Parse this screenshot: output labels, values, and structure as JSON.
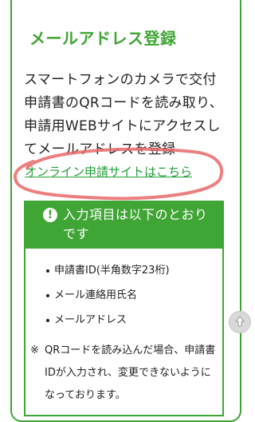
{
  "section": {
    "title": "メールアドレス登録",
    "description": "スマートフォンのカメラで交付申請書のQRコードを読み取り、申請用WEBサイトにアクセスしてメールアドレスを登録",
    "link_label": "オンライン申請サイトはこちら"
  },
  "info": {
    "icon": "exclamation-icon",
    "title": "入力項目は以下のとおりです",
    "items": [
      "申請書ID(半角数字23桁)",
      "メール連絡用氏名",
      "メールアドレス"
    ],
    "note_mark": "※",
    "note": "QRコードを読み込んだ場合、申請書IDが入力され、変更できないようになっております。"
  },
  "colors": {
    "accent": "#3fa535",
    "annotation": "#e86a6a"
  },
  "scroll_top_icon": "arrow-up-icon"
}
